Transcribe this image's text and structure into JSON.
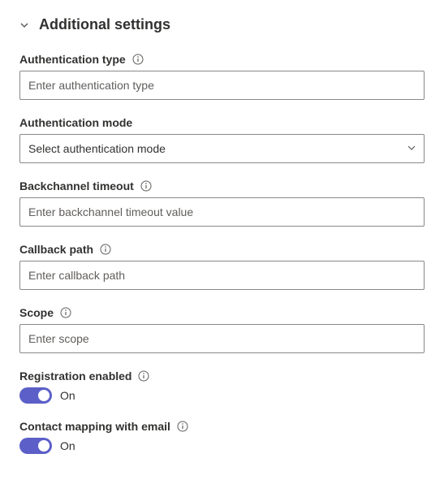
{
  "section": {
    "title": "Additional settings"
  },
  "fields": {
    "authType": {
      "label": "Authentication type",
      "placeholder": "Enter authentication type"
    },
    "authMode": {
      "label": "Authentication mode",
      "placeholder": "Select authentication mode"
    },
    "backchannelTimeout": {
      "label": "Backchannel timeout",
      "placeholder": "Enter backchannel timeout value"
    },
    "callbackPath": {
      "label": "Callback path",
      "placeholder": "Enter callback path"
    },
    "scope": {
      "label": "Scope",
      "placeholder": "Enter scope"
    },
    "registrationEnabled": {
      "label": "Registration enabled",
      "state": "On"
    },
    "contactMapping": {
      "label": "Contact mapping with email",
      "state": "On"
    }
  }
}
